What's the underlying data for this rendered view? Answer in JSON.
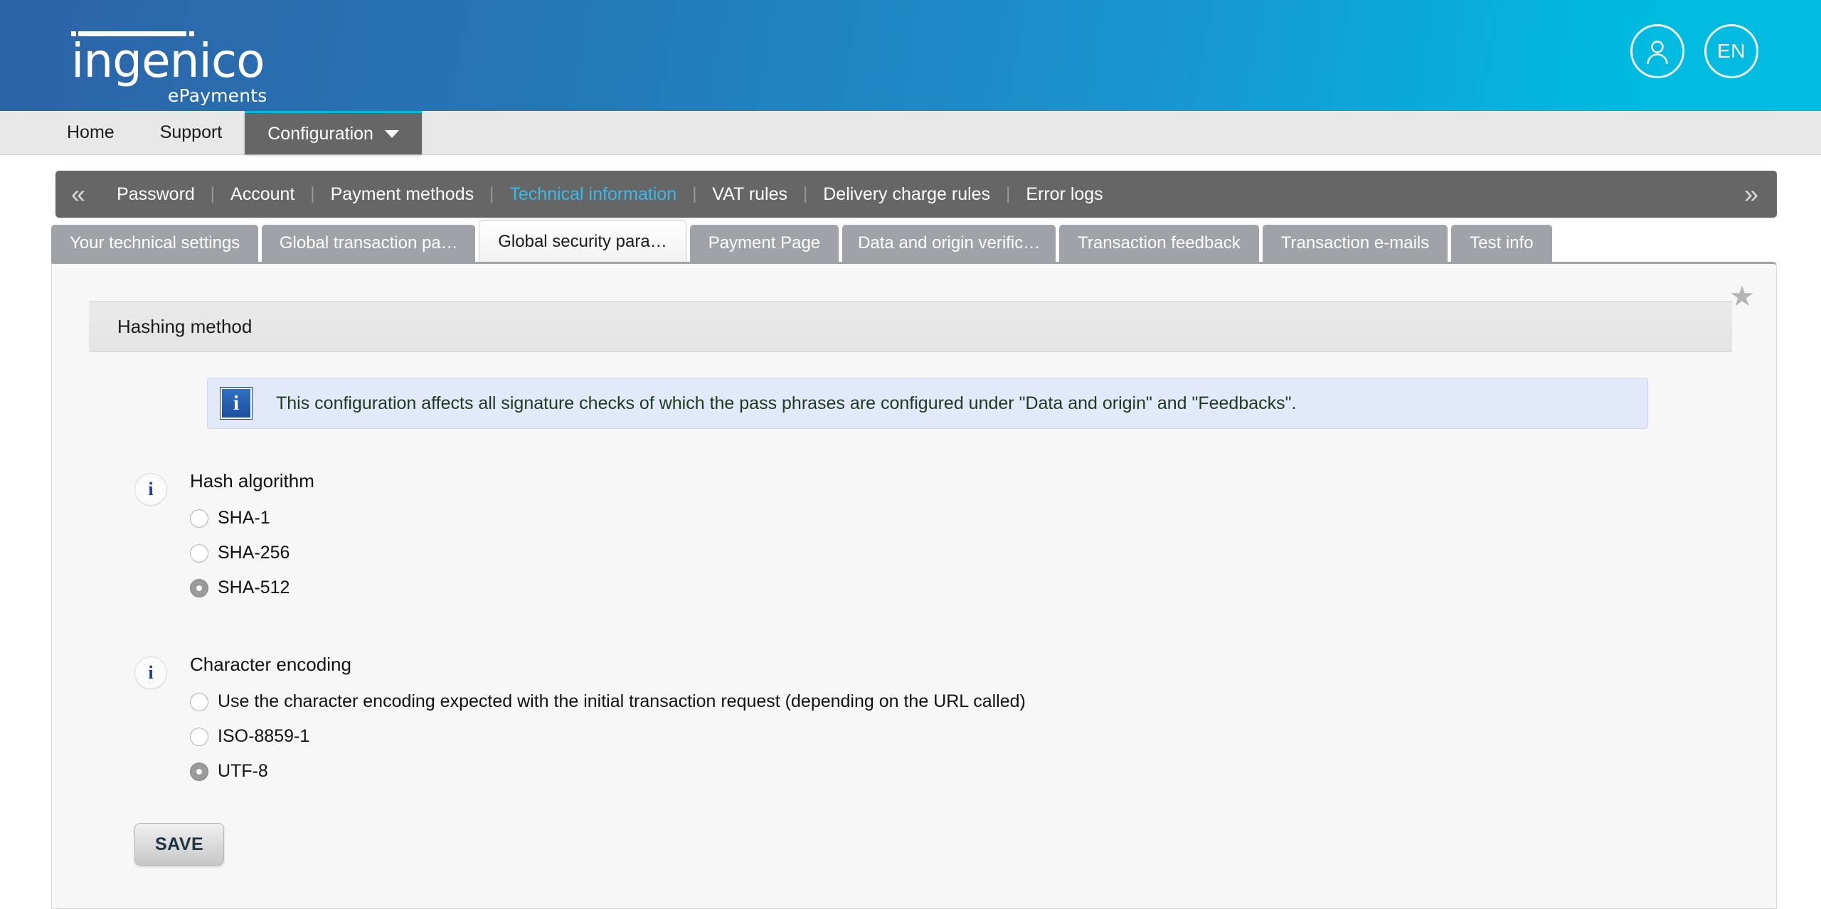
{
  "header": {
    "logo_word": "ingenico",
    "logo_sub": "ePayments",
    "account_icon": "user-avatar-icon",
    "language_label": "EN"
  },
  "menubar": {
    "items": [
      {
        "label": "Home",
        "active": false
      },
      {
        "label": "Support",
        "active": false
      },
      {
        "label": "Configuration",
        "active": true,
        "has_caret": true
      }
    ]
  },
  "subnav": {
    "prev_icon": "«",
    "next_icon": "»",
    "separator": "|",
    "items": [
      {
        "label": "Password",
        "current": false
      },
      {
        "label": "Account",
        "current": false
      },
      {
        "label": "Payment methods",
        "current": false
      },
      {
        "label": "Technical information",
        "current": true
      },
      {
        "label": "VAT rules",
        "current": false
      },
      {
        "label": "Delivery charge rules",
        "current": false
      },
      {
        "label": "Error logs",
        "current": false
      }
    ],
    "current_color": "#3bb9e8"
  },
  "tabs": [
    {
      "label": "Your technical settings",
      "active": false
    },
    {
      "label": "Global transaction pa…",
      "active": false
    },
    {
      "label": "Global security para…",
      "active": true
    },
    {
      "label": "Payment Page",
      "active": false
    },
    {
      "label": "Data and origin verific…",
      "active": false
    },
    {
      "label": "Transaction feedback",
      "active": false
    },
    {
      "label": "Transaction e-mails",
      "active": false
    },
    {
      "label": "Test info",
      "active": false
    }
  ],
  "panel": {
    "favorite_icon": "star-icon",
    "section_title": "Hashing method",
    "info_banner": {
      "icon": "info-square-icon",
      "icon_glyph": "i",
      "text": "This configuration affects all signature checks of which the pass phrases are configured under \"Data and origin\" and \"Feedbacks\".",
      "background": "#e2e9fb"
    },
    "groups": [
      {
        "hint_icon": "info-circle-icon",
        "hint_glyph": "i",
        "title": "Hash algorithm",
        "options": [
          {
            "label": "SHA-1",
            "checked": false
          },
          {
            "label": "SHA-256",
            "checked": false
          },
          {
            "label": "SHA-512",
            "checked": true
          }
        ]
      },
      {
        "hint_icon": "info-circle-icon",
        "hint_glyph": "i",
        "title": "Character encoding",
        "options": [
          {
            "label": "Use the character encoding expected with the initial transaction request (depending on the URL called)",
            "checked": false
          },
          {
            "label": "ISO-8859-1",
            "checked": false
          },
          {
            "label": "UTF-8",
            "checked": true
          }
        ]
      }
    ],
    "save_label": "SAVE"
  }
}
